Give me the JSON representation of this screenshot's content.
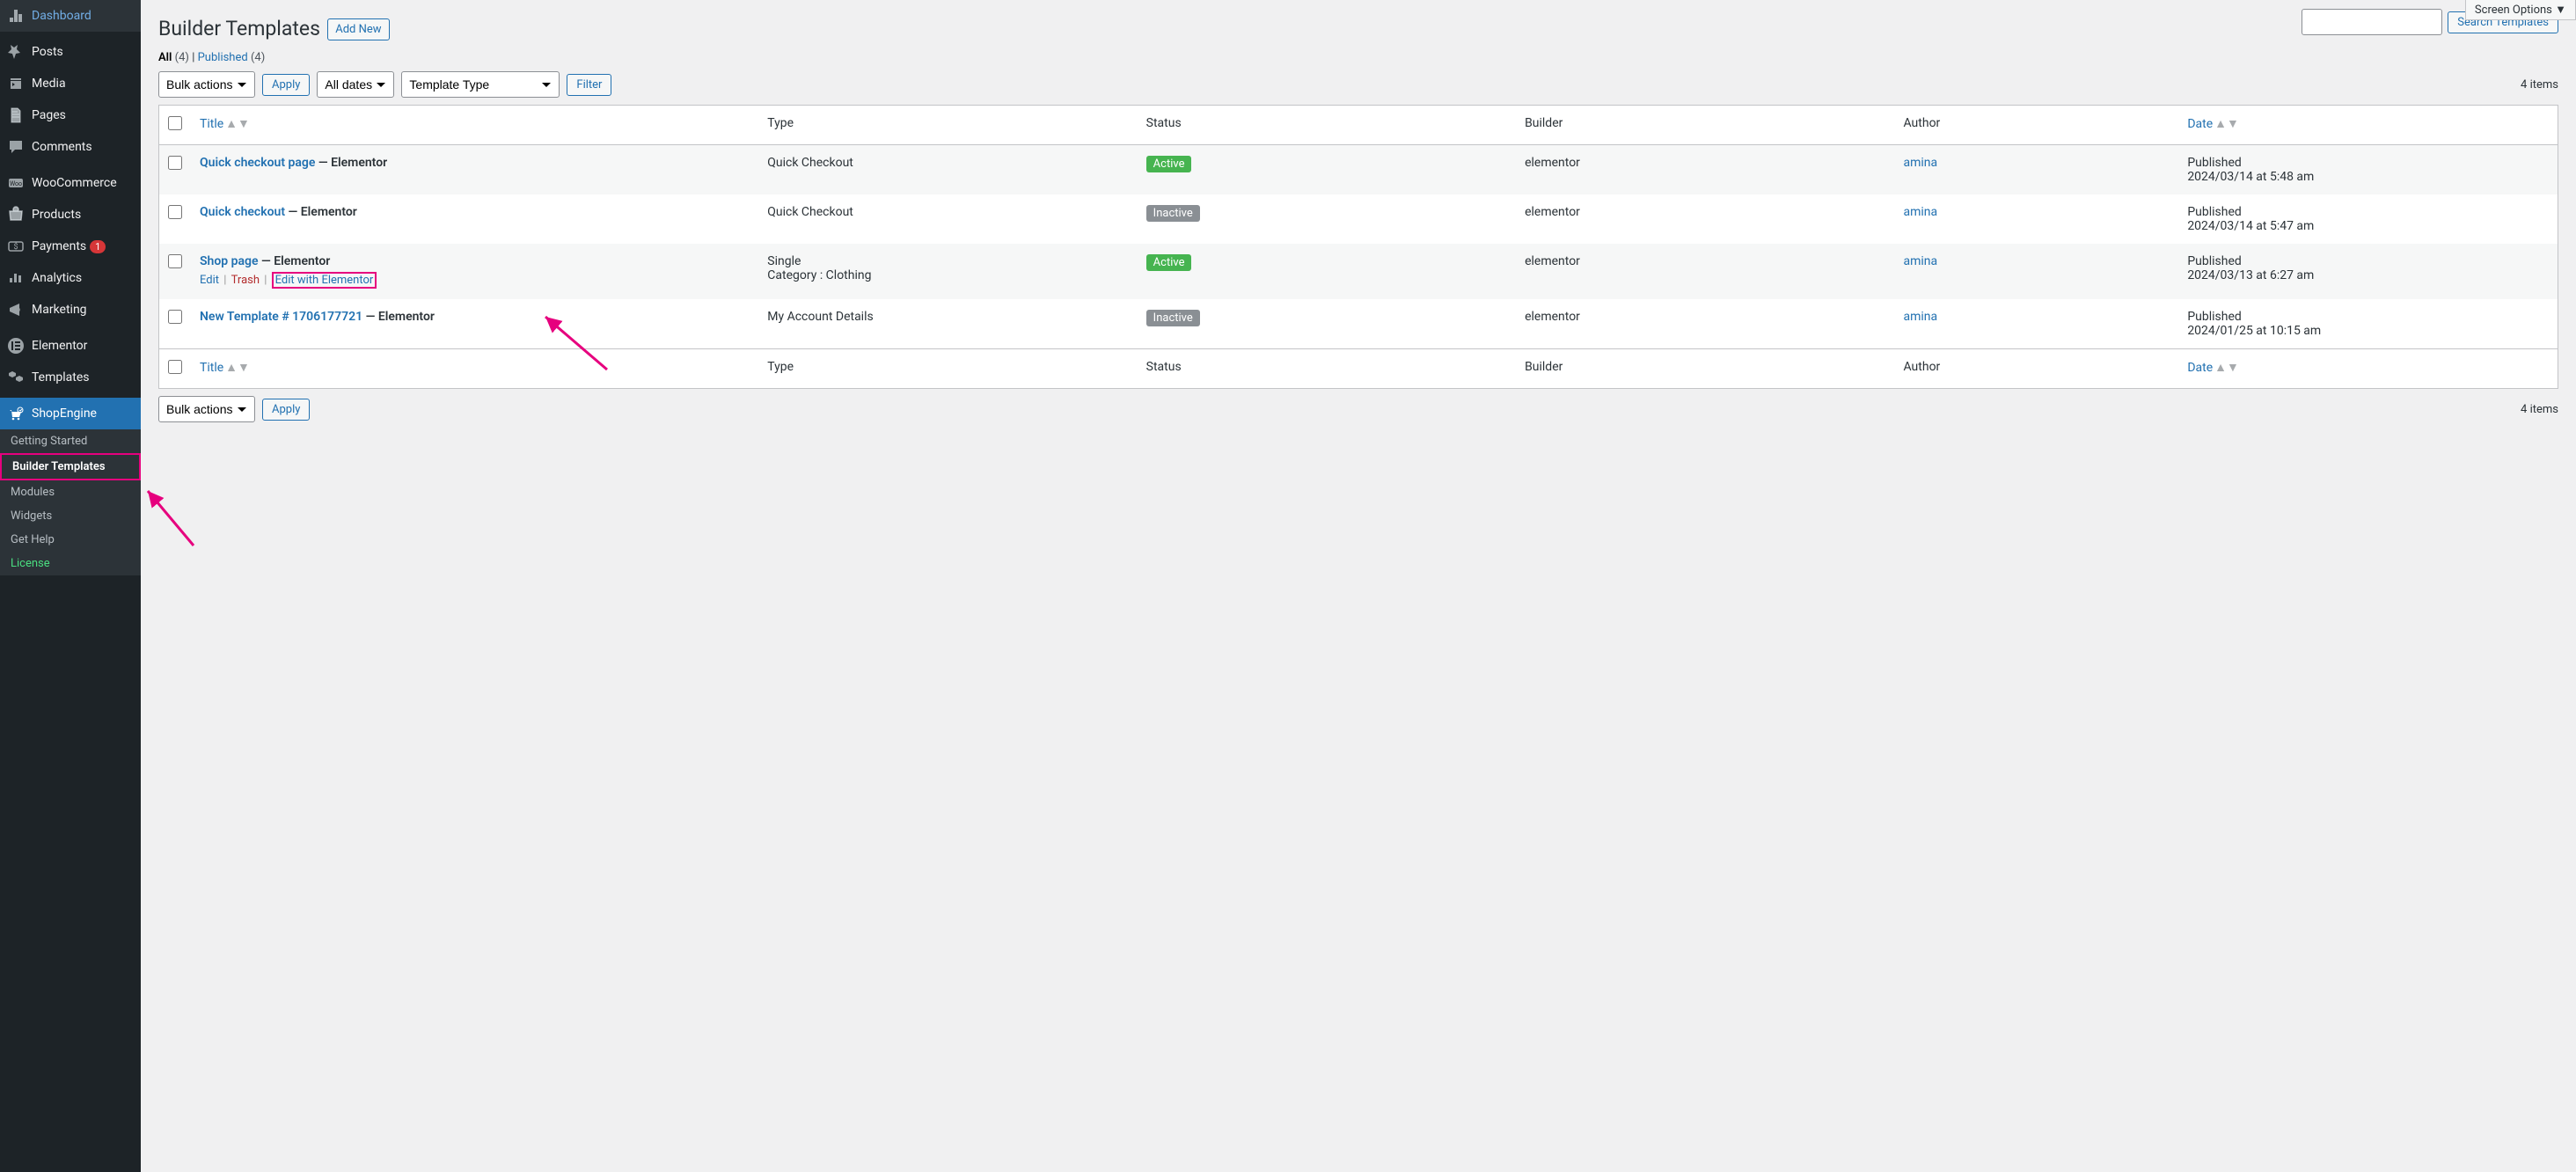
{
  "sidebar": {
    "items": [
      {
        "name": "dashboard",
        "label": "Dashboard",
        "icon": "dashboard"
      },
      {
        "sep": true
      },
      {
        "name": "posts",
        "label": "Posts",
        "icon": "pin"
      },
      {
        "name": "media",
        "label": "Media",
        "icon": "media"
      },
      {
        "name": "pages",
        "label": "Pages",
        "icon": "pages"
      },
      {
        "name": "comments",
        "label": "Comments",
        "icon": "comments"
      },
      {
        "sep": true
      },
      {
        "name": "woocommerce",
        "label": "WooCommerce",
        "icon": "woo"
      },
      {
        "name": "products",
        "label": "Products",
        "icon": "products"
      },
      {
        "name": "payments",
        "label": "Payments",
        "icon": "payments",
        "badge": "1"
      },
      {
        "name": "analytics",
        "label": "Analytics",
        "icon": "analytics"
      },
      {
        "name": "marketing",
        "label": "Marketing",
        "icon": "marketing"
      },
      {
        "sep": true
      },
      {
        "name": "elementor",
        "label": "Elementor",
        "icon": "elementor"
      },
      {
        "name": "templates",
        "label": "Templates",
        "icon": "templates"
      },
      {
        "sep": true
      },
      {
        "name": "shopengine",
        "label": "ShopEngine",
        "icon": "shopengine",
        "active": true
      }
    ],
    "submenu": [
      {
        "name": "getting-started",
        "label": "Getting Started"
      },
      {
        "name": "builder-templates",
        "label": "Builder Templates",
        "current": true
      },
      {
        "name": "modules",
        "label": "Modules"
      },
      {
        "name": "widgets",
        "label": "Widgets"
      },
      {
        "name": "get-help",
        "label": "Get Help"
      },
      {
        "name": "license",
        "label": "License",
        "license": true
      }
    ]
  },
  "header": {
    "page_title": "Builder Templates",
    "add_new": "Add New",
    "screen_options": "Screen Options"
  },
  "filters": {
    "all_label": "All",
    "all_count": "(4)",
    "pub_label": "Published",
    "pub_count": "(4)",
    "bulk": "Bulk actions",
    "apply": "Apply",
    "dates": "All dates",
    "ttype": "Template Type",
    "filter": "Filter",
    "search_btn": "Search Templates",
    "items_count": "4 items"
  },
  "columns": {
    "title": "Title",
    "type": "Type",
    "status": "Status",
    "builder": "Builder",
    "author": "Author",
    "date": "Date"
  },
  "rows": [
    {
      "title": "Quick checkout page",
      "suffix": " — Elementor",
      "type": "Quick Checkout",
      "status": "Active",
      "status_kind": "active",
      "builder": "elementor",
      "author": "amina",
      "date_label": "Published",
      "date_val": "2024/03/14 at 5:48 am"
    },
    {
      "title": "Quick checkout",
      "suffix": " — Elementor",
      "type": "Quick Checkout",
      "status": "Inactive",
      "status_kind": "inactive",
      "builder": "elementor",
      "author": "amina",
      "date_label": "Published",
      "date_val": "2024/03/14 at 5:47 am"
    },
    {
      "title": "Shop page",
      "suffix": " — Elementor",
      "type": "Single",
      "type_sub": "Category : Clothing",
      "status": "Active",
      "status_kind": "active",
      "builder": "elementor",
      "author": "amina",
      "date_label": "Published",
      "date_val": "2024/03/13 at 6:27 am",
      "actions": {
        "edit": "Edit",
        "trash": "Trash",
        "ewe": "Edit with Elementor"
      }
    },
    {
      "title": "New Template # 1706177721",
      "suffix": " — Elementor",
      "type": "My Account Details",
      "status": "Inactive",
      "status_kind": "inactive",
      "builder": "elementor",
      "author": "amina",
      "date_label": "Published",
      "date_val": "2024/01/25 at 10:15 am"
    }
  ]
}
